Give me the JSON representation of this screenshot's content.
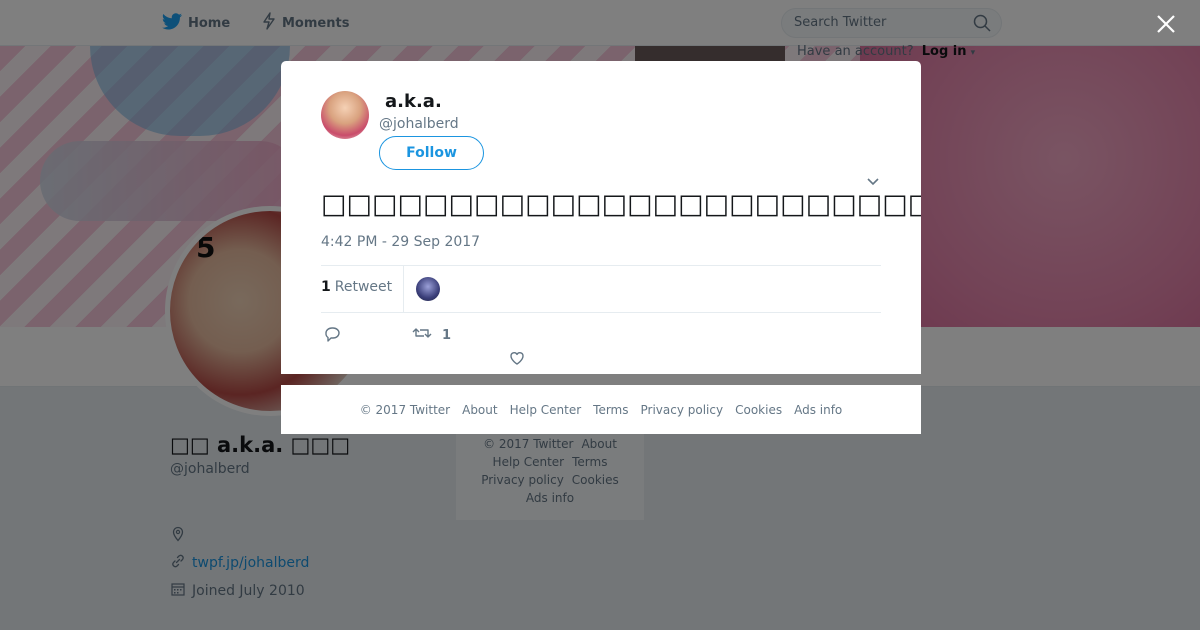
{
  "nav": {
    "home_label": "Home",
    "moments_label": "Moments",
    "search_placeholder": "Search Twitter",
    "account_prompt": "Have an account?",
    "login_label": "Log in"
  },
  "profile": {
    "display_name": "□□ a.k.a. □□□",
    "handle": "@johalberd",
    "website": "twpf.jp/johalberd",
    "joined": "Joined July 2010"
  },
  "background_footer": [
    "© 2017 Twitter",
    "About",
    "Help Center",
    "Terms",
    "Privacy policy",
    "Cookies",
    "Ads info"
  ],
  "tweet": {
    "display_name": "a.k.a.",
    "handle": "@johalberd",
    "follow_label": "Follow",
    "text": "□□□□□□□□□□□□□□□□□□□□□□□□□□□□□",
    "timestamp": "4:42 PM - 29 Sep 2017",
    "retweet_count": "1",
    "retweet_label": "Retweet",
    "action_retweet_count": "1"
  },
  "modal_footer": [
    "© 2017 Twitter",
    "About",
    "Help Center",
    "Terms",
    "Privacy policy",
    "Cookies",
    "Ads info"
  ],
  "colors": {
    "accent": "#1b95e0",
    "text_primary": "#14171a",
    "text_secondary": "#657786"
  },
  "icons": {
    "logo": "twitter-bird-icon",
    "moments": "lightning-icon",
    "search": "search-icon",
    "close": "close-icon",
    "caret": "chevron-down-icon",
    "reply": "reply-icon",
    "retweet": "retweet-icon",
    "like": "heart-icon",
    "location": "location-pin-icon",
    "link": "link-icon",
    "calendar": "calendar-icon"
  }
}
